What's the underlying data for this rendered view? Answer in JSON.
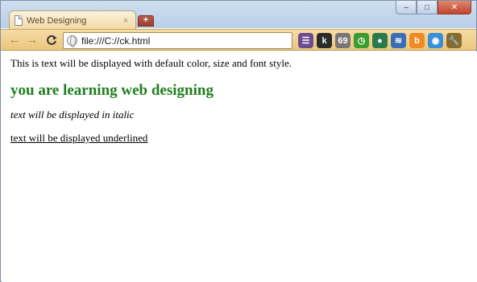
{
  "browser": {
    "tab": {
      "title": "Web Designing",
      "close_glyph": "×"
    },
    "new_tab_glyph": "+",
    "window_controls": {
      "minimize": "–",
      "maximize": "□",
      "close": "✕"
    },
    "nav": {
      "back": "←",
      "forward": "→",
      "reload": "C"
    },
    "address_bar": {
      "url": "file:///C://ck.html"
    },
    "extensions": [
      {
        "name": "bookmarks-manager-icon",
        "glyph": "☰",
        "color": "#6d4b8f"
      },
      {
        "name": "k-extension-icon",
        "glyph": "k",
        "color": "#2a2a2a"
      },
      {
        "name": "counter-extension-icon",
        "glyph": "69",
        "color": "#777777"
      },
      {
        "name": "timer-extension-icon",
        "glyph": "◷",
        "color": "#3b9b2f"
      },
      {
        "name": "globe-extension-icon",
        "glyph": "●",
        "color": "#2b7a4b"
      },
      {
        "name": "stack-extension-icon",
        "glyph": "≋",
        "color": "#3a6fb5"
      },
      {
        "name": "blogger-icon",
        "glyph": "b",
        "color": "#f08a24"
      },
      {
        "name": "camera-extension-icon",
        "glyph": "◉",
        "color": "#3a8fd8"
      },
      {
        "name": "wrench-icon",
        "glyph": "🔧",
        "color": "#8a6a2c"
      }
    ]
  },
  "content": {
    "line1": "This is text will be displayed with default color, size and font style.",
    "heading": "you are learning web designing",
    "italic_line": "text will be displayed in italic",
    "underlined_line": "text will be displayed underlined"
  },
  "colors": {
    "heading_green": "#1f7f1f",
    "tab_bg": "#f3d9a3",
    "toolbar_bg": "#ebc77e"
  }
}
